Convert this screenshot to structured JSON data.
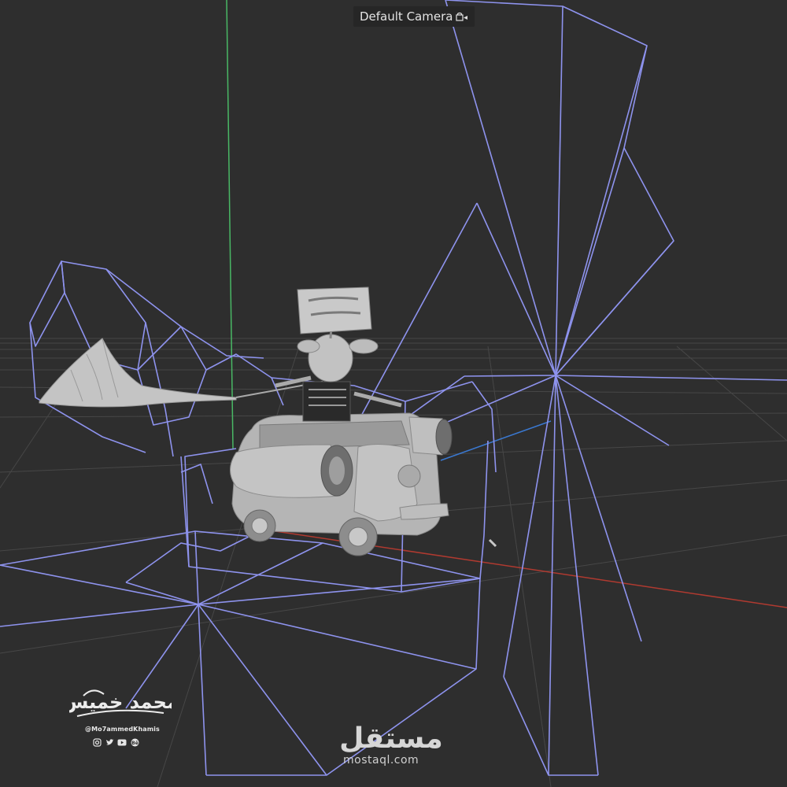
{
  "viewport": {
    "camera_label": "Default Camera",
    "camera_icon": "camera-lock-icon"
  },
  "colors": {
    "background": "#2e2e2e",
    "wireframe": "#8f94f0",
    "axis_y": "#4cc06a",
    "axis_x": "#c0392b",
    "axis_z": "#3a7bd5",
    "grid": "#4a4a4a",
    "model": "#b8b8b8"
  },
  "scene": {
    "model": "van-with-character-and-sign",
    "objects": [
      "cloth-banner",
      "jet-engines",
      "sign-board",
      "character",
      "light-gizmos"
    ]
  },
  "watermark": {
    "signature": "محمد خميس",
    "handle": "@Mo7ammedKhamis",
    "social": [
      "instagram-icon",
      "twitter-icon",
      "youtube-icon",
      "behance-icon"
    ]
  },
  "brand": {
    "logo_text": "مستقل",
    "url": "mostaql.com"
  }
}
